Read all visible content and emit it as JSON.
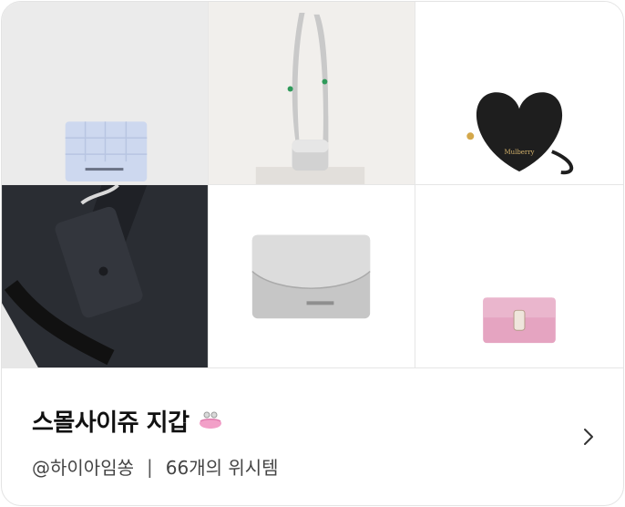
{
  "collection": {
    "title": "스몰사이쥬 지갑",
    "title_icon": "coin-purse-icon",
    "owner": "@하이아임쏭",
    "separator": "|",
    "count_text": "66개의 위시템"
  },
  "items": [
    {
      "icon": "lavender-quilted-wallet-image"
    },
    {
      "icon": "silver-crossbody-mini-bag-image"
    },
    {
      "icon": "black-heart-coin-purse-image"
    },
    {
      "icon": "navy-nylon-tote-with-wallet-image"
    },
    {
      "icon": "silver-flap-wallet-image"
    },
    {
      "icon": "pink-card-wallet-image"
    }
  ],
  "colors": {
    "accent_pink": "#f2a0c8",
    "title": "#111111",
    "meta": "#444444"
  }
}
